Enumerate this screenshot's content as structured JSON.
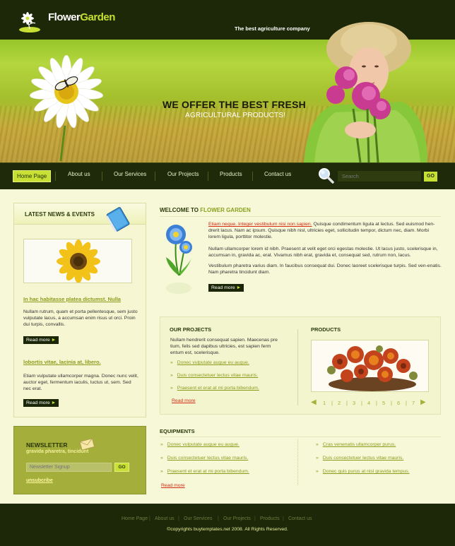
{
  "header": {
    "logo_word1": "Flower",
    "logo_word2": "Garden",
    "tagline": "The best agriculture company",
    "promo_line1": "WE OFFER THE BEST FRESH",
    "promo_line2": "AGRICULTURAL PRODUCTS!"
  },
  "nav": {
    "items": [
      "Home Page",
      "About us",
      "Our Services",
      "Our Projects",
      "Products",
      "Contact us"
    ],
    "active": "Home Page"
  },
  "search": {
    "placeholder": "Search",
    "button": "GO"
  },
  "news": {
    "title": "LATEST NEWS & EVENTS",
    "items": [
      {
        "link": "In hac habitasse platea dictumst. Nulla",
        "text": "Nullam rutrum, quam et porta pellentesque, sem justo vulputate lacus, a accumsan enim risus ut orci. Proin dui turpis, convallis.",
        "button": "Read more"
      },
      {
        "link": "lobortis vitae, lacinia at, libero.",
        "text": "Etiam vulputate ullamcorper magna. Donec nunc velit, auctor eget, fermentum iaculis, luctus ut, sem. Sed nec erat.",
        "button": "Read more"
      }
    ]
  },
  "newsletter": {
    "title": "NEWSLETTER",
    "subtitle": "gravida pharetra, tincidunt",
    "input_placeholder": "Newsletter Signup",
    "button": "GO",
    "unsubscribe": "unsubcribe"
  },
  "welcome": {
    "title_prefix": "WELCOME TO",
    "title_highlight": "FLOWER GARDEN",
    "p1_red": "Etiam neque. Integer vestibulum nisi non sapien.",
    "p1_rest": " Quisque condimentum ligula at lectus. Sed euismod hen-drerit lacus. Nam ac ipsum. Quisque nibh nisl, ultricies eget, sollicitudin tempor, dictum nec, diam. Morbi lorem ligula, porttitor molestie.",
    "p2": "Nullam ullamcorper lorem id nibh. Praesent at velit eget orci egestas molestie. Ut lacus justo, scelerisque in, accumsan in, gravida ac, erat. Vivamus nibh erat, gravida et, consequat sed, rutrum non, lacus.",
    "p3": "Vestibulum pharetra varius diam. In faucibus consequat dui. Donec laoreet scelerisque turpis. Sed ven-enatis. Nam pharetra tincidunt diam.",
    "button": "Read more"
  },
  "projects": {
    "title": "OUR PROJECTS",
    "text": "Nullam hendrerit consequat sapien. Maecenas pre tium, felis sed dapibus ultricies, est sapien ferm entum est, scelerisque.",
    "items": [
      "Donec vulputate augue eu augue.",
      "Duis consectetuer lectus vitae mauris.",
      "Praesent et erat at mi porta bibendum."
    ],
    "more": "Read more"
  },
  "products": {
    "title": "PRODUCTS",
    "pages": [
      "1",
      "2",
      "3",
      "4",
      "5",
      "6",
      "7"
    ]
  },
  "equipments": {
    "title": "EQUIPMENTS",
    "left": [
      "Donec vulputate augue eu augue.",
      "Duis consectetuer lectus vitae mauris.",
      "Praesent et erat at mi porta bibendum."
    ],
    "right": [
      "Cras venenatis ullamcorper purus.",
      "Duis consectetuer lectus vitae mauris.",
      "Donec quis purus at nisl gravida tempus."
    ],
    "more": "Read more"
  },
  "footer": {
    "links": [
      "Home Page",
      "About us",
      "Our Services",
      "Our Projects",
      "Products",
      "Contact us"
    ],
    "copyright": "©copyrights buytemplates.net 2008. All Rights Reserved."
  },
  "colors": {
    "dark": "#1c2807",
    "accent": "#c7e033",
    "link": "#8b9b19",
    "red": "#d42a14"
  }
}
